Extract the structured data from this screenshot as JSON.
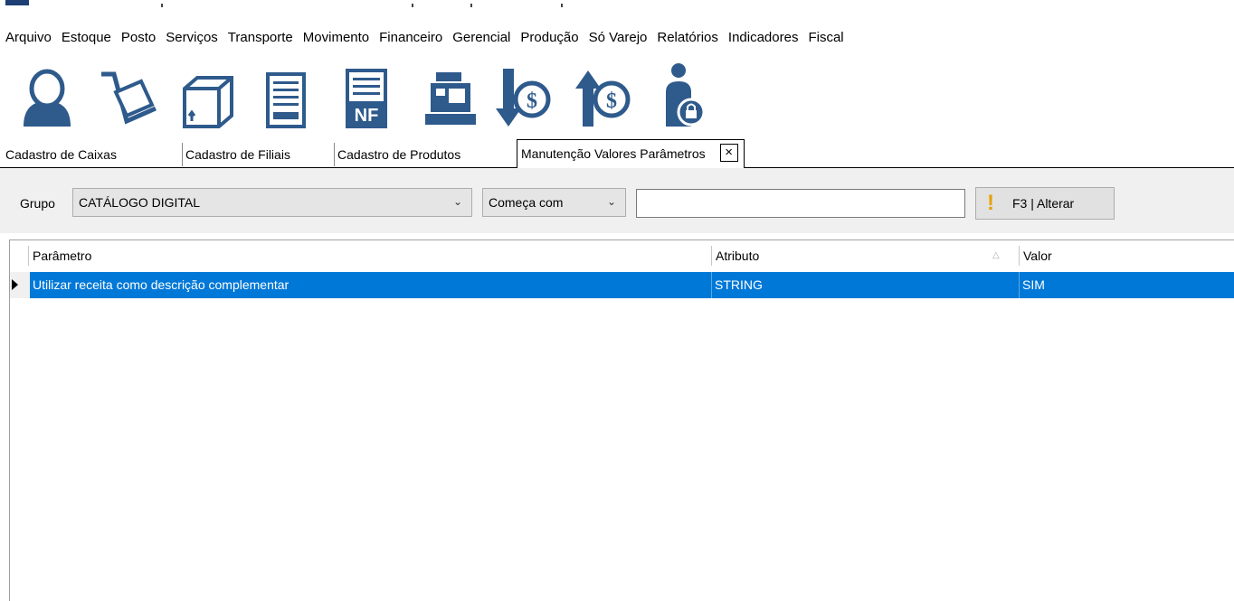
{
  "menu": [
    "Arquivo",
    "Estoque",
    "Posto",
    "Serviços",
    "Transporte",
    "Movimento",
    "Financeiro",
    "Gerencial",
    "Produção",
    "Só Varejo",
    "Relatórios",
    "Indicadores",
    "Fiscal"
  ],
  "toolbar_icons": [
    "user-icon",
    "cart-icon",
    "box-icon",
    "document-icon",
    "nf-document-icon",
    "cash-register-icon",
    "money-down-icon",
    "money-up-icon",
    "user-lock-icon"
  ],
  "tabs": {
    "caixas": "Cadastro de Caixas",
    "filiais": "Cadastro de Filiais",
    "produtos": "Cadastro de Produtos",
    "manutencao": "Manutenção Valores Parâmetros",
    "close": "×"
  },
  "filter": {
    "grupo_label": "Grupo",
    "grupo_value": "CATÁLOGO DIGITAL",
    "match_value": "Começa com",
    "search_value": "",
    "alter_button": "F3 | Alterar"
  },
  "grid": {
    "columns": [
      "Parâmetro",
      "Atributo",
      "Valor"
    ],
    "rows": [
      {
        "parametro": "Utilizar receita como descrição complementar",
        "atributo": "STRING",
        "valor": "SIM"
      }
    ]
  },
  "colors": {
    "selection": "#0078d7",
    "icon_blue": "#2e5a8c",
    "accent_warning": "#e8a000"
  }
}
